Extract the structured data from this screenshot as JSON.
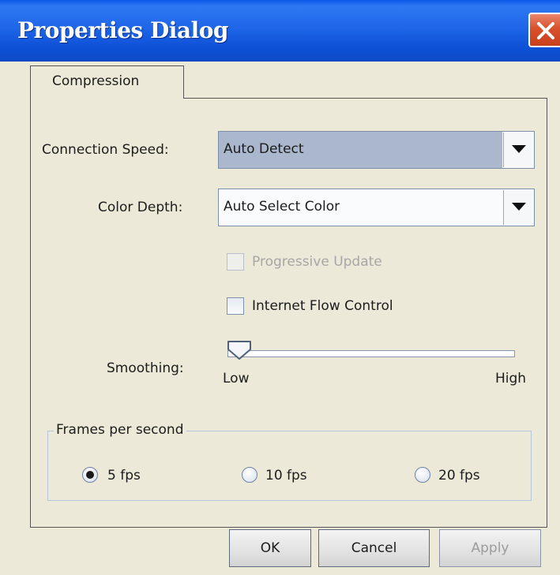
{
  "window": {
    "title": "Properties Dialog"
  },
  "tabs": [
    {
      "label": "Compression"
    }
  ],
  "connection_speed": {
    "label": "Connection Speed:",
    "value": "Auto Detect"
  },
  "color_depth": {
    "label": "Color Depth:",
    "value": "Auto Select Color"
  },
  "progressive_update": {
    "label": "Progressive Update",
    "checked": false,
    "enabled": false
  },
  "internet_flow_control": {
    "label": "Internet Flow Control",
    "checked": false,
    "enabled": true
  },
  "smoothing": {
    "label": "Smoothing:",
    "min_label": "Low",
    "max_label": "High",
    "level": 0
  },
  "frames_per_second": {
    "title": "Frames per second",
    "options": [
      "5 fps",
      "10 fps",
      "20 fps"
    ],
    "selected": "5 fps"
  },
  "buttons": {
    "ok": "OK",
    "cancel": "Cancel",
    "apply": "Apply"
  },
  "colors": {
    "titlebar": "#0f52d8",
    "close_button": "#d9512c",
    "selected_field": "#aab7cc",
    "background": "#ece9d8"
  }
}
